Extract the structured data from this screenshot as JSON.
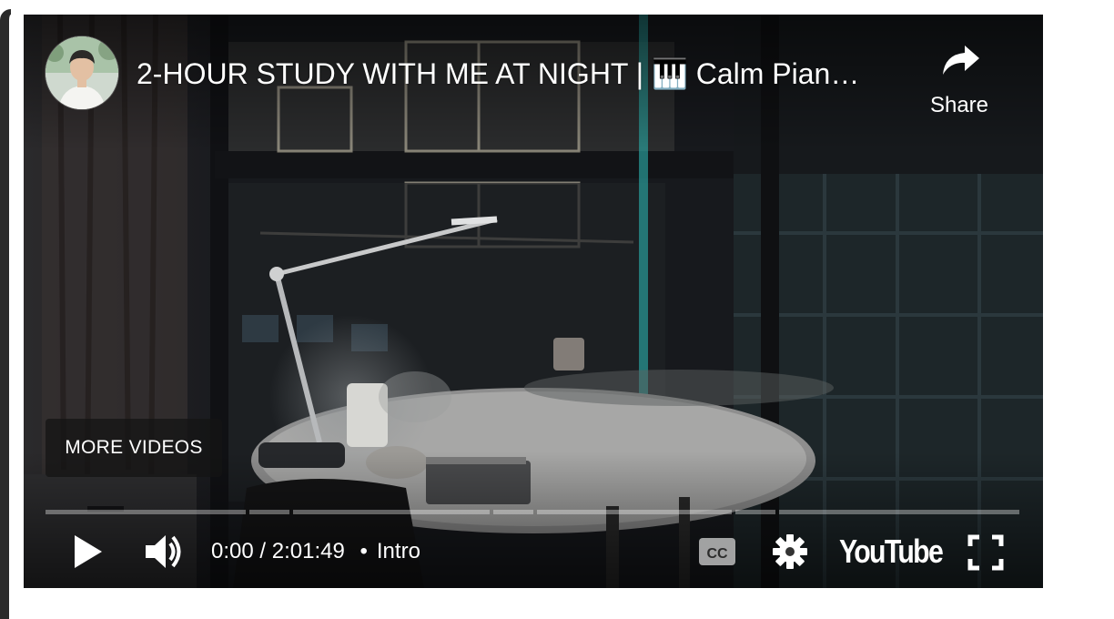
{
  "video": {
    "title": "2-HOUR STUDY WITH ME AT NIGHT | 🎹 Calm Pian…",
    "avatar_icon": "channel-avatar-icon"
  },
  "share": {
    "label": "Share",
    "icon": "share-arrow-icon"
  },
  "more_videos": {
    "label": "MORE VIDEOS"
  },
  "controls": {
    "play_icon": "play-icon",
    "volume_icon": "volume-icon",
    "current_time": "0:00",
    "separator": "/",
    "duration": "2:01:49",
    "chapter_separator": "•",
    "chapter": "Intro",
    "cc_label": "CC",
    "settings_icon": "gear-icon",
    "brand": "YouTube",
    "fullscreen_icon": "fullscreen-icon"
  },
  "progress": {
    "played_fraction": 0,
    "chapter_markers": [
      "0:00",
      "chapter-2",
      "chapter-3",
      "chapter-4",
      "chapter-5",
      "chapter-6",
      "chapter-7"
    ]
  },
  "colors": {
    "text": "#ffffff",
    "progress_track": "rgba(255,255,255,0.35)"
  }
}
